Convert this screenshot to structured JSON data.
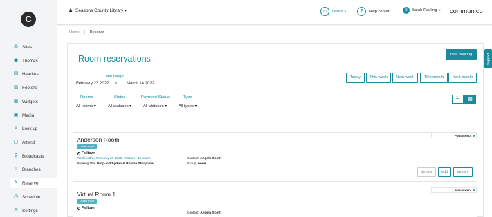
{
  "app": {
    "logo_letter": "C",
    "brand": "communico"
  },
  "topbar": {
    "org": "Seasons County Library",
    "users_label": "Users",
    "help_label": "Help center",
    "user_name": "Sarah Pauling",
    "user_initial": "S"
  },
  "sidebar": {
    "items": [
      {
        "label": "Sites",
        "icon": "globe-icon",
        "glyph": "◍"
      },
      {
        "label": "Themes",
        "icon": "palette-icon",
        "glyph": "◉"
      },
      {
        "label": "Headers",
        "icon": "header-icon",
        "glyph": "▤"
      },
      {
        "label": "Footers",
        "icon": "footer-icon",
        "glyph": "▥"
      },
      {
        "label": "Widgets",
        "icon": "widget-icon",
        "glyph": "▦"
      },
      {
        "label": "Media",
        "icon": "media-icon",
        "glyph": "▣"
      },
      {
        "label": "Look up",
        "icon": "search-icon",
        "glyph": "⌕"
      },
      {
        "label": "Attend",
        "icon": "calendar-icon",
        "glyph": "▢"
      },
      {
        "label": "Broadcasts",
        "icon": "broadcast-icon",
        "glyph": "⚲"
      },
      {
        "label": "Branches",
        "icon": "branch-icon",
        "glyph": "⌂"
      },
      {
        "label": "Reserve",
        "icon": "reserve-icon",
        "glyph": "✎"
      },
      {
        "label": "Schedule",
        "icon": "clock-icon",
        "glyph": "◷"
      },
      {
        "label": "Settings",
        "icon": "gear-icon",
        "glyph": "⚙"
      }
    ],
    "active": "Reserve"
  },
  "breadcrumb": {
    "home": "Home",
    "current": "Reserve"
  },
  "page": {
    "title": "Room reservations",
    "new_booking": "new booking",
    "support": "Support"
  },
  "date_filter": {
    "label": "Date range",
    "from": "February 23 2022",
    "to_word": "to",
    "to": "March 14 2022"
  },
  "range_buttons": [
    "Today",
    "This week",
    "Next week",
    "This month",
    "Next month"
  ],
  "filters": [
    {
      "label": "Rooms",
      "value": "All rooms ▾"
    },
    {
      "label": "Status",
      "value": "All statuses ▾"
    },
    {
      "label": "Payment Status",
      "value": "All statuses ▾"
    },
    {
      "label": "Type",
      "value": "All types ▾"
    }
  ],
  "views": [
    {
      "name": "list-view",
      "glyph": "☰",
      "selected": false
    },
    {
      "name": "calendar-view",
      "glyph": "▦",
      "selected": true
    }
  ],
  "reservations": [
    {
      "title": "Anderson Room",
      "tag": "Library event",
      "location": "Falltown",
      "date": "Wednesday, February 23 2022, 9:30am - 11:15am",
      "booking_label": "Booking title:",
      "booking_title": "Drop-in Rhythm & Rhyme Storytime",
      "contact_label": "Contact:",
      "contact": "Angela Scott",
      "group_label": "Group:",
      "group": "none",
      "status": "PUBLISHED",
      "buttons": {
        "details": "details",
        "edit": "edit",
        "more": "more ▾"
      }
    },
    {
      "title": "Virtual Room 1",
      "tag": "Library event",
      "location": "Falltown",
      "contact_label": "Contact:",
      "contact": "Angela Scott",
      "status": "PUBLISHED"
    }
  ],
  "colors": {
    "accent": "#1b8a9c",
    "published": "#27ae60"
  }
}
